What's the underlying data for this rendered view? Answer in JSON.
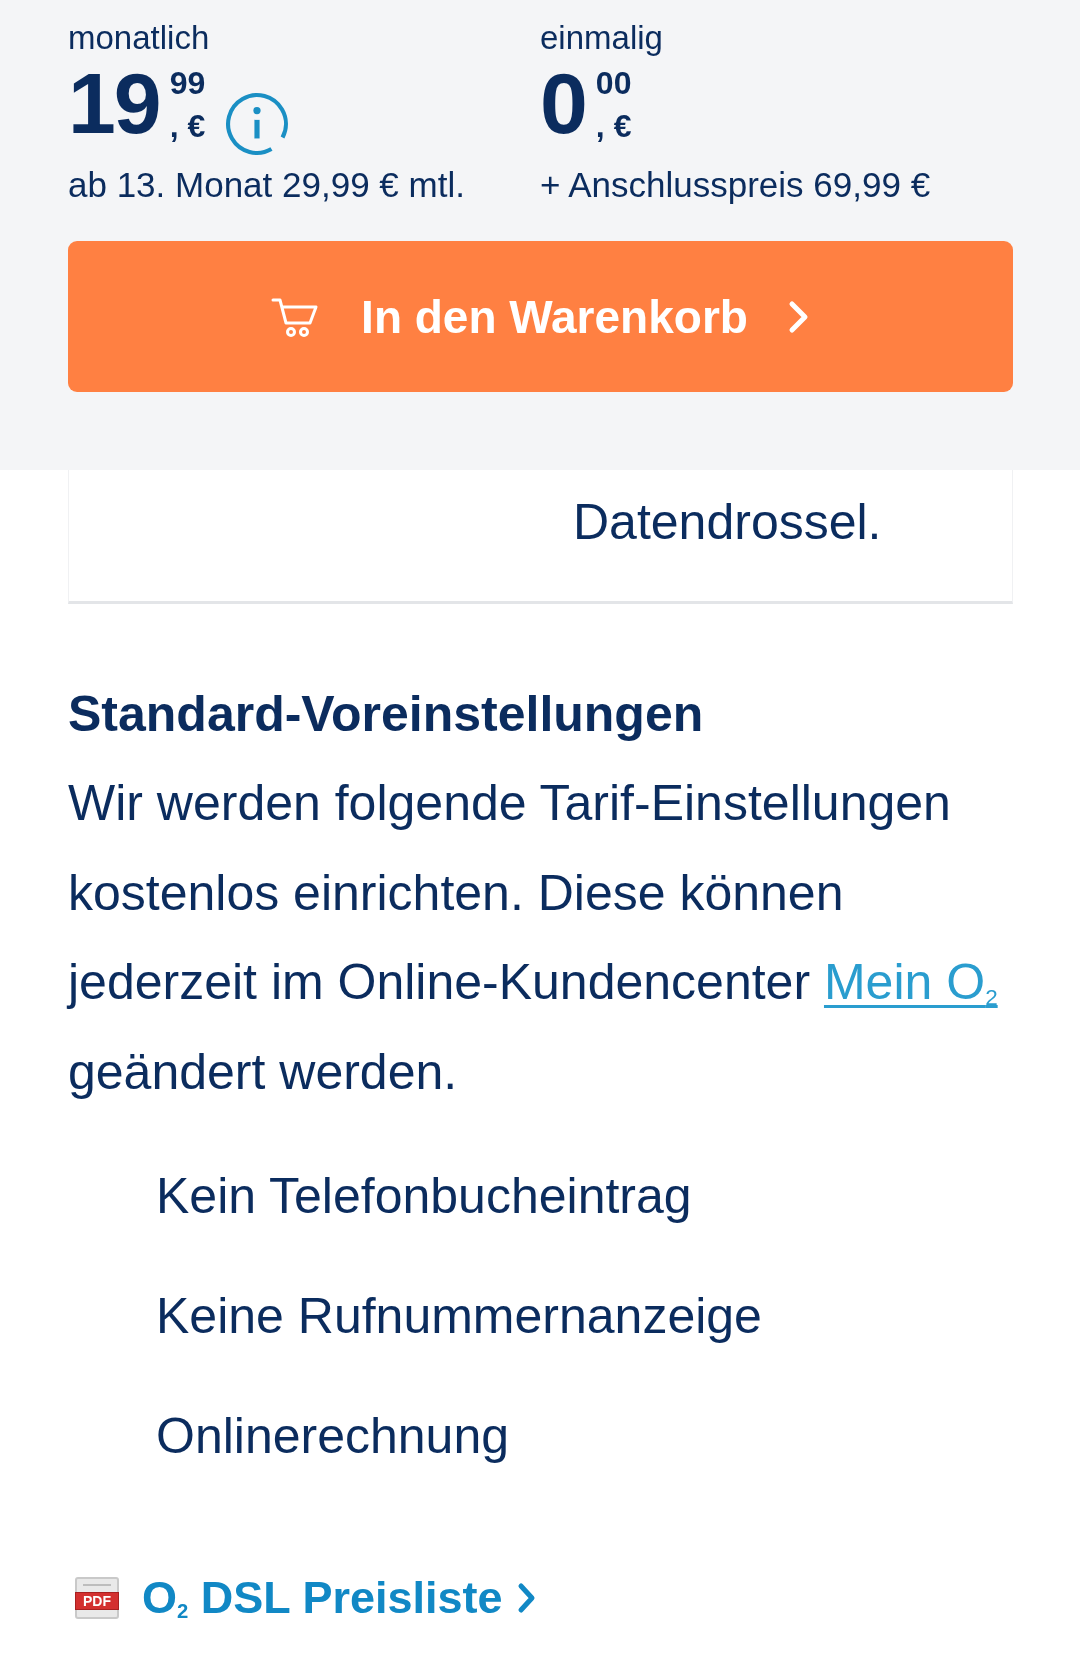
{
  "price_panel": {
    "prices": [
      {
        "label": "monatlich",
        "amount": "19",
        "cents": "99",
        "currency": ", €",
        "info": true,
        "note": "ab 13. Monat 29,99 € mtl."
      },
      {
        "label": "einmalig",
        "amount": "0",
        "cents": "00",
        "currency": ", €",
        "info": false,
        "note": "+ Anschlusspreis 69,99 €"
      }
    ],
    "cart_button": {
      "label": "In den Warenkorb"
    }
  },
  "tariff_card": {
    "text": "Datendrossel."
  },
  "default_settings": {
    "title": "Standard-Voreinstellungen",
    "text_before": "Wir werden folgende Tarif-Einstellungen kostenlos einrichten. Diese können jederzeit im Online-Kundencenter",
    "link": "Mein O$_{2}$",
    "text_after": "geändert werden.",
    "items": [
      "Kein Telefonbucheintrag",
      "Keine Rufnummernanzeige",
      "Onlinerechnung"
    ]
  },
  "price_list_link": {
    "icon_text": "PDF",
    "label": "O$_{2}$ DSL Preisliste"
  }
}
